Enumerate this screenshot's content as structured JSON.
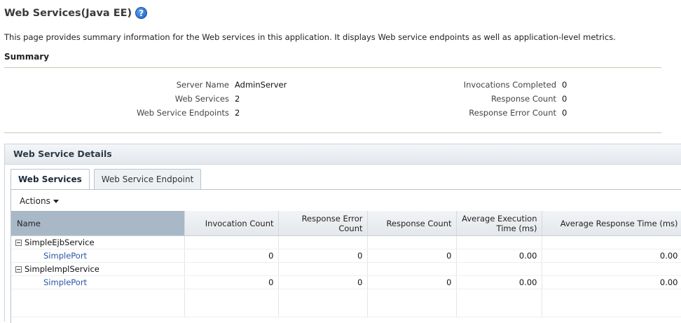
{
  "page": {
    "title": "Web Services(Java EE)",
    "help_icon": "question-mark-icon",
    "description": "This page provides summary information for the Web services in this application. It displays Web service endpoints as well as application-level metrics."
  },
  "summary": {
    "heading": "Summary",
    "left": [
      {
        "label": "Server Name",
        "value": "AdminServer"
      },
      {
        "label": "Web Services",
        "value": "2"
      },
      {
        "label": "Web Service Endpoints",
        "value": "2"
      }
    ],
    "right": [
      {
        "label": "Invocations Completed",
        "value": "0"
      },
      {
        "label": "Response Count",
        "value": "0"
      },
      {
        "label": "Response Error Count",
        "value": "0"
      }
    ]
  },
  "details": {
    "heading": "Web Service Details",
    "tabs": [
      {
        "label": "Web Services",
        "active": true
      },
      {
        "label": "Web Service Endpoint",
        "active": false
      }
    ],
    "actions_label": "Actions",
    "table": {
      "columns": [
        "Name",
        "Invocation Count",
        "Response Error Count",
        "Response Count",
        "Average Execution Time (ms)",
        "Average Response Time (ms)"
      ],
      "groups": [
        {
          "service": "SimpleEjbService",
          "rows": [
            {
              "name": "SimplePort",
              "invocation_count": "0",
              "response_error_count": "0",
              "response_count": "0",
              "avg_execution_time": "0.00",
              "avg_response_time": "0.00"
            }
          ]
        },
        {
          "service": "SimpleImplService",
          "rows": [
            {
              "name": "SimplePort",
              "invocation_count": "0",
              "response_error_count": "0",
              "response_count": "0",
              "avg_execution_time": "0.00",
              "avg_response_time": "0.00"
            }
          ]
        }
      ]
    }
  }
}
